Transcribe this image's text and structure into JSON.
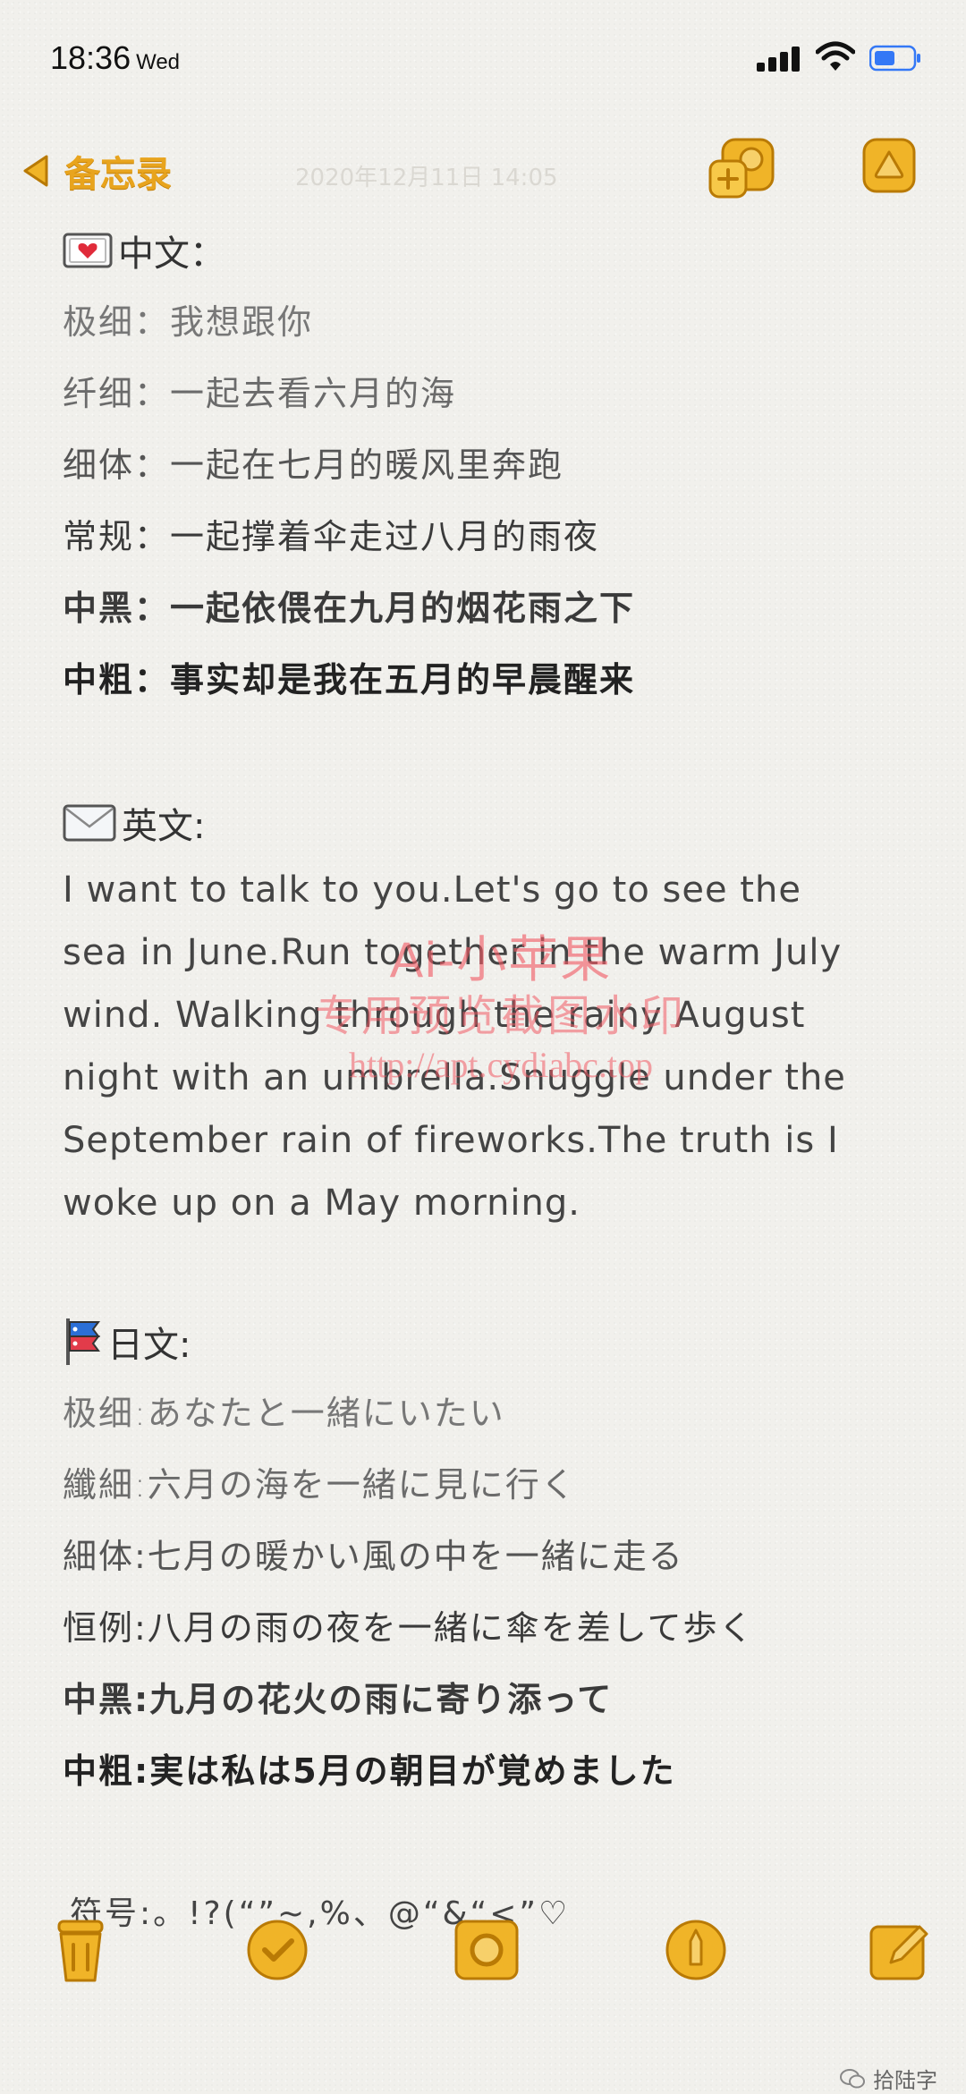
{
  "status_bar": {
    "time": "18:36",
    "day": "Wed"
  },
  "nav": {
    "back_label": "备忘录",
    "date": "2020年12月11日 14:05"
  },
  "chinese": {
    "heading": "中文：",
    "lines": [
      "极细：我想跟你",
      "纤细：一起去看六月的海",
      "细体：一起在七月的暖风里奔跑",
      "常规：一起撑着伞走过八月的雨夜",
      "中黑：一起依偎在九月的烟花雨之下",
      "中粗：事实却是我在五月的早晨醒来"
    ]
  },
  "english": {
    "heading": "英文:",
    "lines": [
      "I want to talk to you.Let's go to see the",
      "sea in June.Run together in the warm July",
      "wind. Walking through the rainy August",
      "night with an umbrella.Snuggle under the",
      "September rain of fireworks.The truth is I",
      "woke up on a May morning."
    ]
  },
  "japanese": {
    "heading": "日文:",
    "lines": [
      "极细:あなたと一緒にいたい",
      "纖細:六月の海を一緒に見に行く",
      "細体:七月の暖かい風の中を一緒に走る",
      "恒例:八月の雨の夜を一緒に傘を差して歩く",
      "中黑:九月の花火の雨に寄り添って",
      "中粗:実は私は5月の朝目が覚めました"
    ]
  },
  "symbols": "符号:。!?(“”~,%、@“&“<”♡",
  "watermark": {
    "line1": "Ai-小苹果",
    "line2": "专用预览截图水印",
    "line3": "http://apt.cydiabc.top"
  },
  "credit": "拾陆字",
  "colors": {
    "accent": "#e8a41e",
    "accent_dark": "#b97a05",
    "background": "#f1f0ec",
    "watermark": "#f05a64"
  },
  "icons": {
    "toolbar": [
      "trash-icon",
      "checklist-icon",
      "camera-icon",
      "markup-pen-icon",
      "compose-icon"
    ],
    "nav": [
      "add-people-icon",
      "share-icon"
    ]
  }
}
